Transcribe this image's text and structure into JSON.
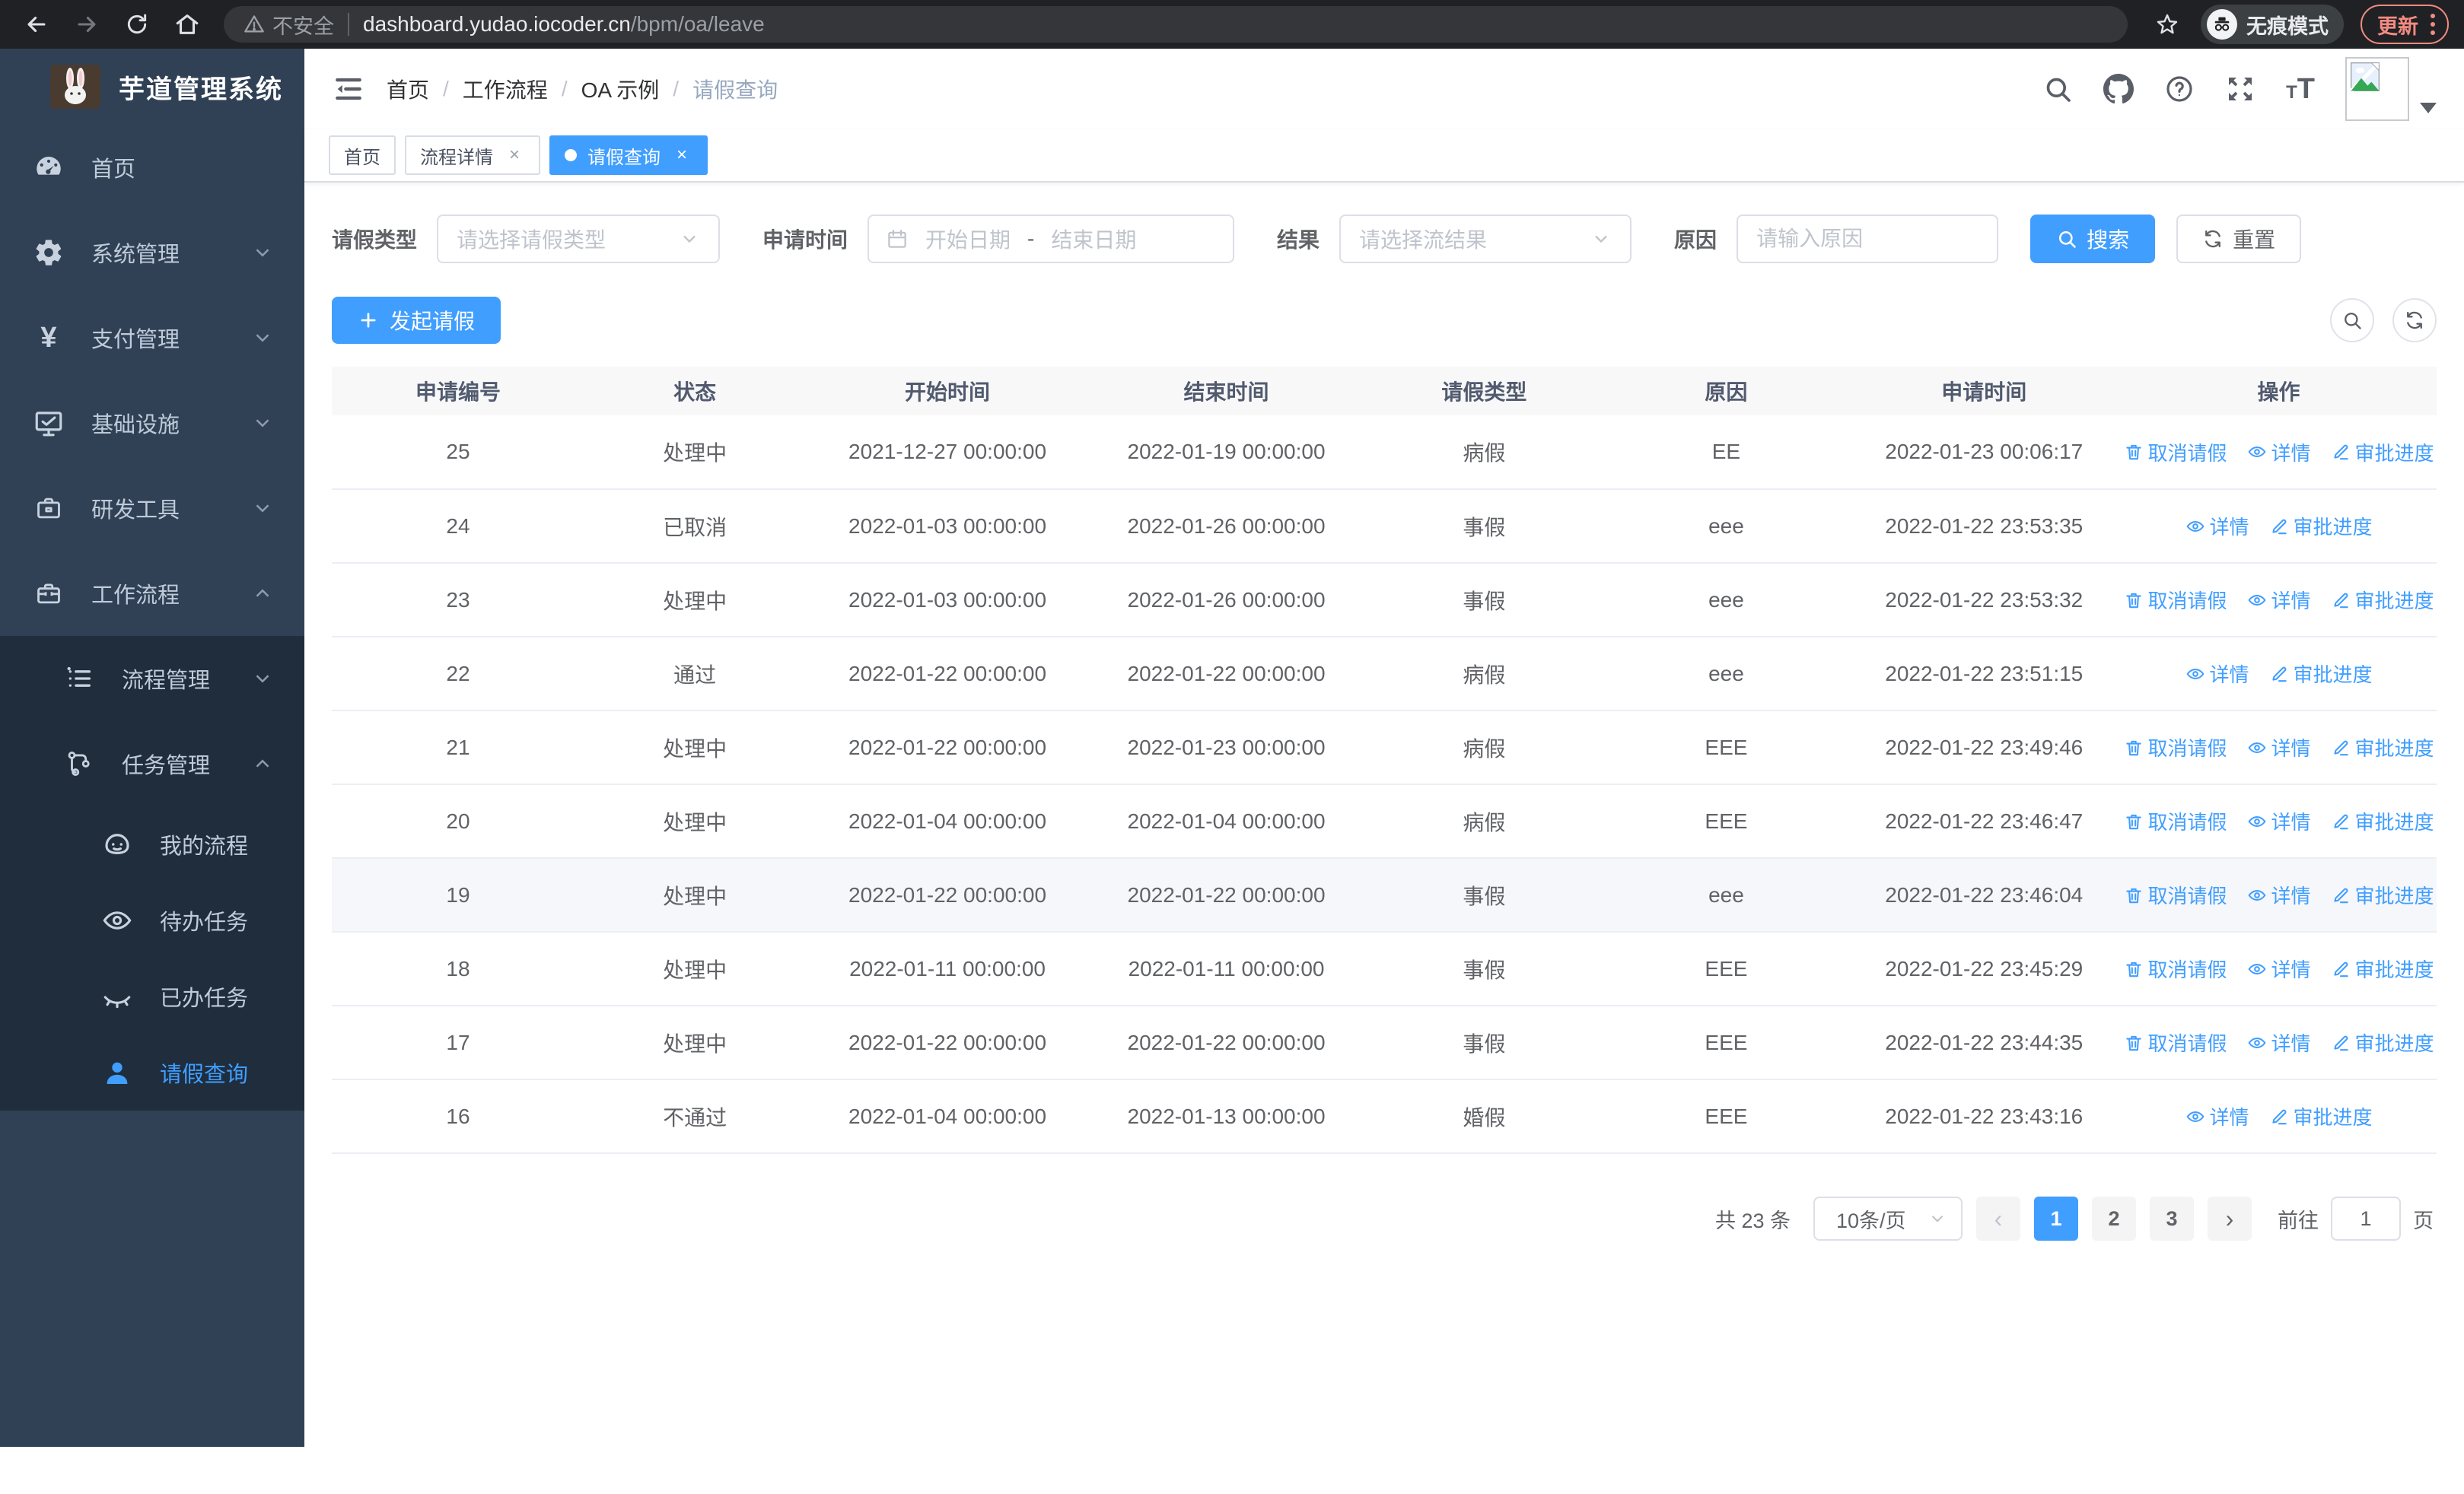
{
  "colors": {
    "accent": "#409eff",
    "sidebar_bg": "#304156",
    "submenu_bg": "#1f2d3d",
    "update": "#f28b82"
  },
  "browser": {
    "security_label": "不安全",
    "url_host": "dashboard.yudao.iocoder.cn",
    "url_path": "/bpm/oa/leave",
    "incognito_label": "无痕模式",
    "update_label": "更新"
  },
  "sidebar": {
    "app_title": "芋道管理系统",
    "items": [
      {
        "label": "首页",
        "icon": "dashboard-icon",
        "arrow": null,
        "active": false
      },
      {
        "label": "系统管理",
        "icon": "gear-icon",
        "arrow": "down",
        "active": false
      },
      {
        "label": "支付管理",
        "icon": "yen-icon",
        "arrow": "down",
        "active": false
      },
      {
        "label": "基础设施",
        "icon": "monitor-icon",
        "arrow": "down",
        "active": false
      },
      {
        "label": "研发工具",
        "icon": "briefcase-icon",
        "arrow": "down",
        "active": false
      },
      {
        "label": "工作流程",
        "icon": "toolbox-icon",
        "arrow": "up",
        "active": false,
        "expanded": true,
        "children": [
          {
            "label": "流程管理",
            "icon": "list-icon",
            "arrow": "down",
            "active": false
          },
          {
            "label": "任务管理",
            "icon": "tree-icon",
            "arrow": "up",
            "active": false,
            "expanded": true,
            "children": [
              {
                "label": "我的流程",
                "icon": "face-icon",
                "active": false
              },
              {
                "label": "待办任务",
                "icon": "eye-icon",
                "active": false
              },
              {
                "label": "已办任务",
                "icon": "eye-closed-icon",
                "active": false
              },
              {
                "label": "请假查询",
                "icon": "user-icon",
                "active": true
              }
            ]
          }
        ]
      }
    ]
  },
  "header": {
    "breadcrumb": [
      "首页",
      "工作流程",
      "OA 示例",
      "请假查询"
    ]
  },
  "tabs": [
    {
      "label": "首页",
      "closable": false,
      "active": false
    },
    {
      "label": "流程详情",
      "closable": true,
      "active": false
    },
    {
      "label": "请假查询",
      "closable": true,
      "active": true
    }
  ],
  "filters": {
    "leave_type": {
      "label": "请假类型",
      "placeholder": "请选择请假类型"
    },
    "apply_time": {
      "label": "申请时间",
      "start_placeholder": "开始日期",
      "separator": "-",
      "end_placeholder": "结束日期"
    },
    "result": {
      "label": "结果",
      "placeholder": "请选择流结果"
    },
    "reason": {
      "label": "原因",
      "placeholder": "请输入原因"
    },
    "search_label": "搜索",
    "reset_label": "重置"
  },
  "toolbar": {
    "create_label": "发起请假"
  },
  "table": {
    "headers": [
      "申请编号",
      "状态",
      "开始时间",
      "结束时间",
      "请假类型",
      "原因",
      "申请时间",
      "操作"
    ],
    "col_widths": [
      "12%",
      "10.5%",
      "13.5%",
      "13%",
      "11.5%",
      "11.5%",
      "13%",
      "15%"
    ],
    "action_labels": {
      "cancel": "取消请假",
      "detail": "详情",
      "progress": "审批进度"
    },
    "rows": [
      {
        "id": "25",
        "status": "处理中",
        "start": "2021-12-27 00:00:00",
        "end": "2022-01-19 00:00:00",
        "type": "病假",
        "reason": "EE",
        "applied": "2022-01-23 00:06:17",
        "actions": [
          "cancel",
          "detail",
          "progress"
        ],
        "highlighted": false
      },
      {
        "id": "24",
        "status": "已取消",
        "start": "2022-01-03 00:00:00",
        "end": "2022-01-26 00:00:00",
        "type": "事假",
        "reason": "eee",
        "applied": "2022-01-22 23:53:35",
        "actions": [
          "detail",
          "progress"
        ],
        "highlighted": false
      },
      {
        "id": "23",
        "status": "处理中",
        "start": "2022-01-03 00:00:00",
        "end": "2022-01-26 00:00:00",
        "type": "事假",
        "reason": "eee",
        "applied": "2022-01-22 23:53:32",
        "actions": [
          "cancel",
          "detail",
          "progress"
        ],
        "highlighted": false
      },
      {
        "id": "22",
        "status": "通过",
        "start": "2022-01-22 00:00:00",
        "end": "2022-01-22 00:00:00",
        "type": "病假",
        "reason": "eee",
        "applied": "2022-01-22 23:51:15",
        "actions": [
          "detail",
          "progress"
        ],
        "highlighted": false
      },
      {
        "id": "21",
        "status": "处理中",
        "start": "2022-01-22 00:00:00",
        "end": "2022-01-23 00:00:00",
        "type": "病假",
        "reason": "EEE",
        "applied": "2022-01-22 23:49:46",
        "actions": [
          "cancel",
          "detail",
          "progress"
        ],
        "highlighted": false
      },
      {
        "id": "20",
        "status": "处理中",
        "start": "2022-01-04 00:00:00",
        "end": "2022-01-04 00:00:00",
        "type": "病假",
        "reason": "EEE",
        "applied": "2022-01-22 23:46:47",
        "actions": [
          "cancel",
          "detail",
          "progress"
        ],
        "highlighted": false
      },
      {
        "id": "19",
        "status": "处理中",
        "start": "2022-01-22 00:00:00",
        "end": "2022-01-22 00:00:00",
        "type": "事假",
        "reason": "eee",
        "applied": "2022-01-22 23:46:04",
        "actions": [
          "cancel",
          "detail",
          "progress"
        ],
        "highlighted": true
      },
      {
        "id": "18",
        "status": "处理中",
        "start": "2022-01-11 00:00:00",
        "end": "2022-01-11 00:00:00",
        "type": "事假",
        "reason": "EEE",
        "applied": "2022-01-22 23:45:29",
        "actions": [
          "cancel",
          "detail",
          "progress"
        ],
        "highlighted": false
      },
      {
        "id": "17",
        "status": "处理中",
        "start": "2022-01-22 00:00:00",
        "end": "2022-01-22 00:00:00",
        "type": "事假",
        "reason": "EEE",
        "applied": "2022-01-22 23:44:35",
        "actions": [
          "cancel",
          "detail",
          "progress"
        ],
        "highlighted": false
      },
      {
        "id": "16",
        "status": "不通过",
        "start": "2022-01-04 00:00:00",
        "end": "2022-01-13 00:00:00",
        "type": "婚假",
        "reason": "EEE",
        "applied": "2022-01-22 23:43:16",
        "actions": [
          "detail",
          "progress"
        ],
        "highlighted": false
      }
    ]
  },
  "pagination": {
    "total_label": "共 23 条",
    "page_size_label": "10条/页",
    "pages": [
      "1",
      "2",
      "3"
    ],
    "current_page": "1",
    "goto_label": "前往",
    "goto_value": "1",
    "page_unit": "页"
  }
}
